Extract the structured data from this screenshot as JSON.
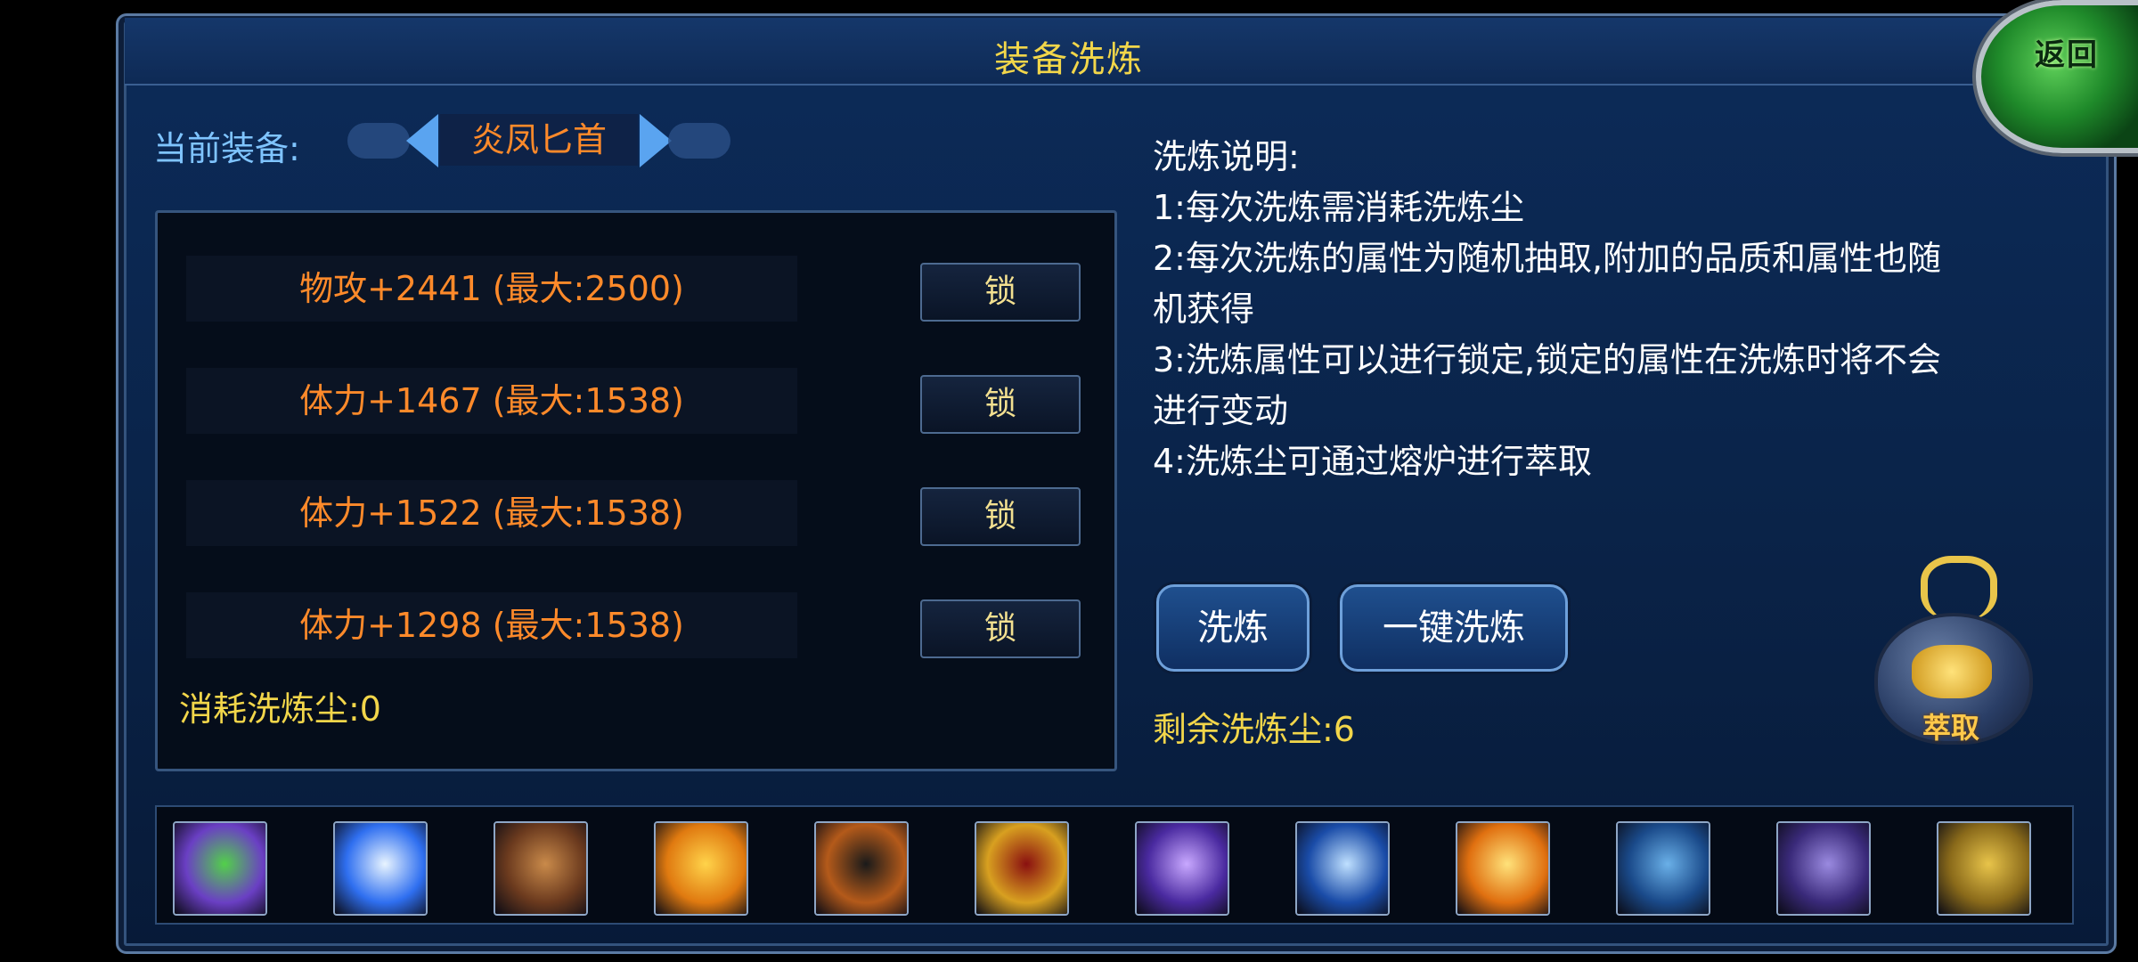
{
  "title": "装备洗炼",
  "back_button": {
    "label": "返回"
  },
  "current_equipment": {
    "label": "当前装备:",
    "name": "炎凤匕首"
  },
  "stats": [
    {
      "text": "物攻+2441  (最大:2500)",
      "lock_label": "锁"
    },
    {
      "text": "体力+1467  (最大:1538)",
      "lock_label": "锁"
    },
    {
      "text": "体力+1522  (最大:1538)",
      "lock_label": "锁"
    },
    {
      "text": "体力+1298  (最大:1538)",
      "lock_label": "锁"
    }
  ],
  "consume": "消耗洗炼尘:0",
  "description": {
    "heading": "洗炼说明:",
    "items": [
      "1:每次洗炼需消耗洗炼尘",
      "2:每次洗炼的属性为随机抽取,附加的品质和属性也随\n机获得",
      "3:洗炼属性可以进行锁定,锁定的属性在洗炼时将不会\n进行变动",
      "4:洗炼尘可通过熔炉进行萃取"
    ]
  },
  "buttons": {
    "refine": "洗炼",
    "one_click_refine": "一键洗炼"
  },
  "remaining": "剩余洗炼尘:6",
  "extract_button": {
    "label": "萃取",
    "icon": "cauldron-icon"
  },
  "skills": [
    {
      "icon": "green-sword-icon",
      "color": "#6a3fc4",
      "accent": "#52d04a"
    },
    {
      "icon": "lightning-icon",
      "color": "#2f6ff0",
      "accent": "#e8f4ff"
    },
    {
      "icon": "helmet-icon",
      "color": "#6b3a1e",
      "accent": "#c98a4a"
    },
    {
      "icon": "golden-shield-icon",
      "color": "#e07a10",
      "accent": "#ffd34a"
    },
    {
      "icon": "shadow-figure-icon",
      "color": "#b45a1a",
      "accent": "#1a1a1a"
    },
    {
      "icon": "red-slash-icon",
      "color": "#d8a020",
      "accent": "#8a1010"
    },
    {
      "icon": "purple-blade-icon",
      "color": "#4a2aa0",
      "accent": "#c8a8ff"
    },
    {
      "icon": "blue-claw-icon",
      "color": "#1a4ca8",
      "accent": "#bfe0ff"
    },
    {
      "icon": "fire-body-icon",
      "color": "#e07010",
      "accent": "#ffe27a"
    },
    {
      "icon": "blue-giant-icon",
      "color": "#1a4a8a",
      "accent": "#6ab0e8"
    },
    {
      "icon": "purple-strike-icon",
      "color": "#3a2a7a",
      "accent": "#9a8ae0"
    },
    {
      "icon": "meditation-icon",
      "color": "#8a6a1a",
      "accent": "#e8c44a"
    }
  ]
}
